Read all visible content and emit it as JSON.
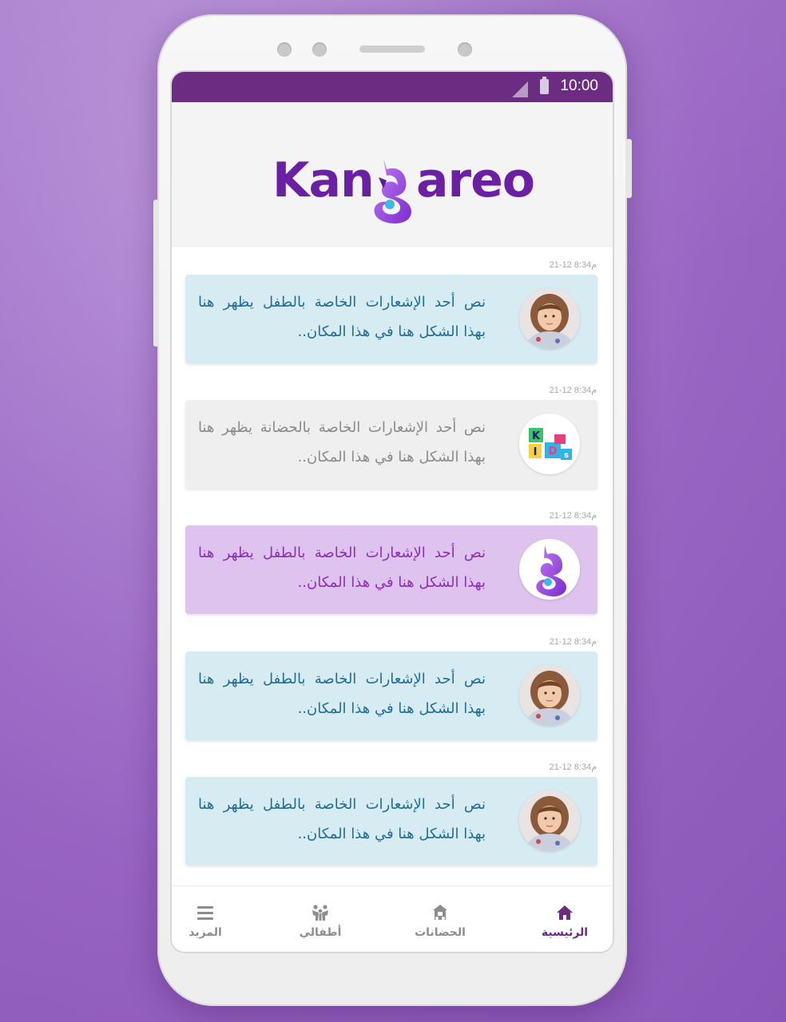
{
  "statusbar": {
    "time": "10:00"
  },
  "app": {
    "logo_left": "Kan",
    "logo_right": "areo"
  },
  "notifications": [
    {
      "time": "21-12 8:34م",
      "text": "نص أحد الإشعارات الخاصة بالطفل يظهر هنا بهذا الشكل هنا في هذا المكان..",
      "type": "child",
      "avatar": "child-photo"
    },
    {
      "time": "21-12 8:34م",
      "text": "نص أحد الإشعارات الخاصة بالحضانة يظهر هنا بهذا الشكل هنا في هذا المكان..",
      "type": "nursery",
      "avatar": "kids-logo"
    },
    {
      "time": "21-12 8:34م",
      "text": "نص أحد الإشعارات الخاصة بالطفل يظهر هنا بهذا الشكل هنا في هذا المكان..",
      "type": "app",
      "avatar": "kangaroo-logo"
    },
    {
      "time": "21-12 8:34م",
      "text": "نص أحد الإشعارات الخاصة بالطفل يظهر هنا بهذا الشكل هنا في هذا المكان..",
      "type": "child",
      "avatar": "child-photo"
    },
    {
      "time": "21-12 8:34م",
      "text": "نص أحد الإشعارات الخاصة بالطفل يظهر هنا بهذا الشكل هنا في هذا المكان..",
      "type": "child",
      "avatar": "child-photo"
    }
  ],
  "nav": {
    "home": {
      "label": "الرئيسية",
      "icon": "home-icon"
    },
    "nurseries": {
      "label": "الحضانات",
      "icon": "nursery-icon"
    },
    "children": {
      "label": "أطفالي",
      "icon": "children-icon"
    },
    "more": {
      "label": "المزيد",
      "icon": "menu-icon"
    }
  },
  "colors": {
    "brand": "#6c2c82",
    "logo": "#6b1fa2",
    "child_card": "#d6ebf2",
    "nursery_card": "#efefef",
    "app_card": "#dfc3ef"
  }
}
